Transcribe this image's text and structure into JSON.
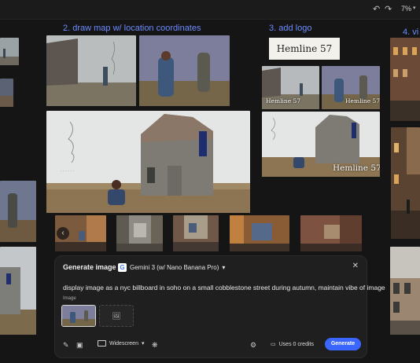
{
  "toolbar": {
    "undo_icon": "undo-icon",
    "redo_icon": "redo-icon",
    "zoom": "7%"
  },
  "steps": {
    "step2": "2. draw map w/ location coordinates",
    "step3": "3. add logo",
    "step4": "4. vi"
  },
  "logo": {
    "text": "Hemline 57"
  },
  "watermarks": {
    "small_a": "Hemline 57",
    "small_b": "Hemline 57",
    "large": "Hemline 57"
  },
  "strip": {
    "prev_icon": "chevron-left-icon"
  },
  "generate_panel": {
    "title": "Generate image",
    "model": "Gemini 3 (w/ Nano Banana Pro)",
    "prompt": "display image as a nyc billboard in soho on a small cobblestone street during autumn, maintain vibe of image",
    "image_label": "Image",
    "aspect": "Widescreen",
    "credits": "Uses 0 credits",
    "generate_label": "Generate"
  },
  "colors": {
    "accent": "#3a66ff",
    "step_text": "#6c8cff",
    "canvas": "#151515",
    "panel": "#1f1f1f"
  }
}
